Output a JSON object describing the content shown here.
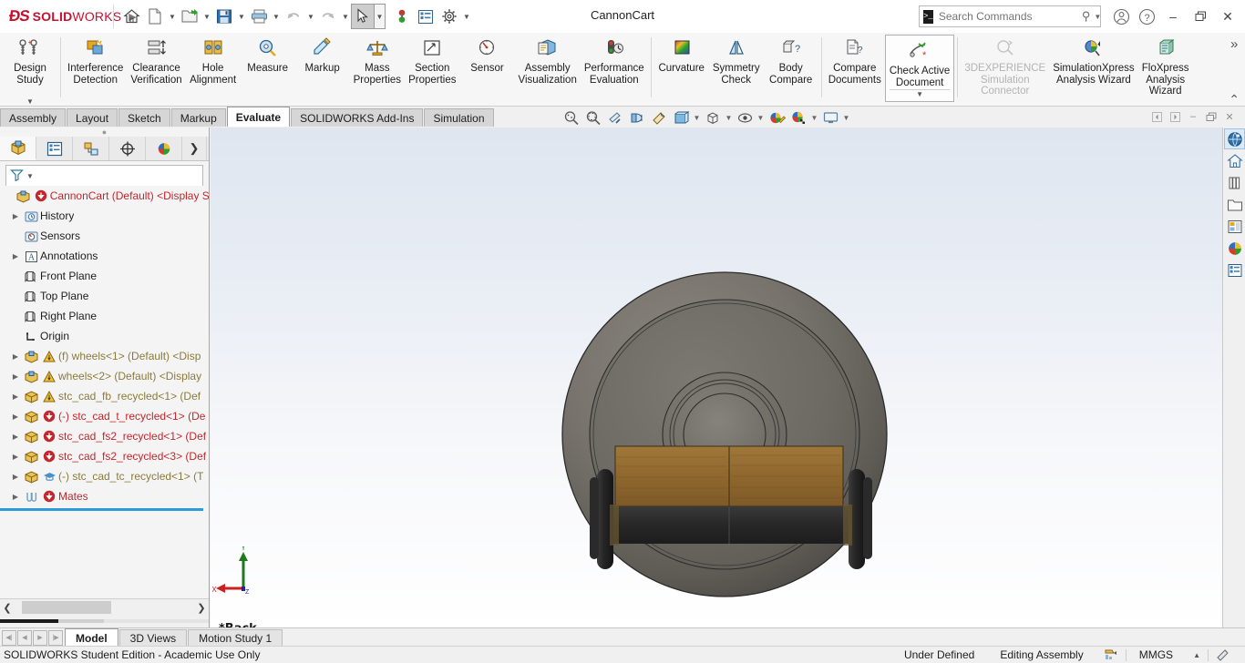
{
  "app": {
    "brand_ds": "2S",
    "brand_bold": "SOLID",
    "brand_light": "WORKS",
    "document_title": "CannonCart",
    "accent_red": "#c8102e",
    "accent_blue": "#2e9bd6"
  },
  "quick_access": [
    {
      "name": "home-icon",
      "label": "Home"
    },
    {
      "name": "new-document-icon",
      "label": "New",
      "caret": true
    },
    {
      "name": "open-folder-icon",
      "label": "Open",
      "caret": true
    },
    {
      "name": "save-icon",
      "label": "Save",
      "caret": true
    },
    {
      "name": "print-icon",
      "label": "Print",
      "caret": true
    },
    {
      "name": "undo-icon",
      "label": "Undo",
      "caret": true
    },
    {
      "name": "redo-icon",
      "label": "Redo",
      "caret": true
    },
    {
      "name": "select-cursor-icon",
      "label": "Select",
      "caret": true,
      "selected": true
    },
    {
      "name": "rebuild-icon",
      "label": "Rebuild"
    },
    {
      "name": "file-properties-icon",
      "label": "File Properties"
    },
    {
      "name": "options-gear-icon",
      "label": "Options",
      "caret": true
    }
  ],
  "titlebar_right": {
    "search_placeholder": "Search Commands",
    "search_value": "",
    "prompt_glyph": ">_",
    "search_icon": "search-icon",
    "search_caret": "chevron-down-icon",
    "account_icon": "user-account-icon",
    "help_icon": "help-question-icon",
    "minimize": "–",
    "restore": "❐",
    "close": "✕"
  },
  "ribbon": {
    "groups": [
      {
        "items": [
          {
            "name": "design-study-button",
            "label": "Design\nStudy",
            "icon": "design-study-icon",
            "dropdown": true,
            "disabled": false
          }
        ]
      },
      {
        "items": [
          {
            "name": "interference-detection-button",
            "label": "Interference\nDetection",
            "icon": "interference-detection-icon",
            "disabled": false
          },
          {
            "name": "clearance-verification-button",
            "label": "Clearance\nVerification",
            "icon": "clearance-verification-icon",
            "disabled": false
          },
          {
            "name": "hole-alignment-button",
            "label": "Hole\nAlignment",
            "icon": "hole-alignment-icon",
            "disabled": false
          },
          {
            "name": "measure-button",
            "label": "Measure",
            "icon": "measure-icon",
            "disabled": false
          },
          {
            "name": "markup-button",
            "label": "Markup",
            "icon": "markup-icon",
            "disabled": false
          },
          {
            "name": "mass-properties-button",
            "label": "Mass\nProperties",
            "icon": "mass-properties-icon",
            "disabled": false
          },
          {
            "name": "section-properties-button",
            "label": "Section\nProperties",
            "icon": "section-properties-icon",
            "disabled": false
          },
          {
            "name": "sensor-button",
            "label": "Sensor",
            "icon": "sensor-icon",
            "disabled": false
          },
          {
            "name": "assembly-visualization-button",
            "label": "Assembly\nVisualization",
            "icon": "assembly-visualization-icon",
            "disabled": false
          },
          {
            "name": "performance-evaluation-button",
            "label": "Performance\nEvaluation",
            "icon": "performance-evaluation-icon",
            "disabled": false
          }
        ]
      },
      {
        "items": [
          {
            "name": "curvature-button",
            "label": "Curvature",
            "icon": "curvature-icon",
            "disabled": false
          },
          {
            "name": "symmetry-check-button",
            "label": "Symmetry\nCheck",
            "icon": "symmetry-check-icon",
            "disabled": false
          },
          {
            "name": "body-compare-button",
            "label": "Body\nCompare",
            "icon": "body-compare-icon",
            "disabled": false
          }
        ]
      },
      {
        "items": [
          {
            "name": "compare-documents-button",
            "label": "Compare\nDocuments",
            "icon": "compare-documents-icon",
            "disabled": false
          },
          {
            "name": "check-active-document-button",
            "label": "Check Active\nDocument",
            "icon": "check-active-document-icon",
            "boxed": true,
            "dropdown": true,
            "disabled": false
          }
        ]
      },
      {
        "items": [
          {
            "name": "3dexperience-simulation-connector-button",
            "label": "3DEXPERIENCE\nSimulation\nConnector",
            "icon": "3dexperience-connector-icon",
            "disabled": true
          },
          {
            "name": "simulationxpress-analysis-wizard-button",
            "label": "SimulationXpress\nAnalysis Wizard",
            "icon": "simulationxpress-icon",
            "disabled": false
          },
          {
            "name": "floxpress-analysis-wizard-button",
            "label": "FloXpress\nAnalysis\nWizard",
            "icon": "floxpress-icon",
            "disabled": false
          }
        ]
      }
    ],
    "overflow_label": "»",
    "collapse_label": "⌃"
  },
  "command_tabs": [
    {
      "name": "tab-assembly",
      "label": "Assembly",
      "active": false
    },
    {
      "name": "tab-layout",
      "label": "Layout",
      "active": false
    },
    {
      "name": "tab-sketch",
      "label": "Sketch",
      "active": false
    },
    {
      "name": "tab-markup",
      "label": "Markup",
      "active": false
    },
    {
      "name": "tab-evaluate",
      "label": "Evaluate",
      "active": true
    },
    {
      "name": "tab-solidworks-add-ins",
      "label": "SOLIDWORKS Add-Ins",
      "active": false
    },
    {
      "name": "tab-simulation",
      "label": "Simulation",
      "active": false
    }
  ],
  "view_toolbar": [
    {
      "name": "zoom-to-fit-icon",
      "caret": false
    },
    {
      "name": "zoom-to-area-icon",
      "caret": false
    },
    {
      "name": "section-view-icon",
      "caret": false
    },
    {
      "name": "view-orientation-icon",
      "caret": false
    },
    {
      "name": "display-style-icon",
      "caret": false
    },
    {
      "name": "hide-show-items-icon",
      "caret": true
    },
    {
      "name": "view-setting-cube-icon",
      "caret": true
    },
    {
      "name": "apply-scene-eye-icon",
      "caret": true
    },
    {
      "name": "edit-appearance-icon",
      "caret": false
    },
    {
      "name": "apply-scene-icon",
      "caret": true
    },
    {
      "name": "view-settings-monitor-icon",
      "caret": true
    }
  ],
  "window_controls": {
    "prev": "◀",
    "next": "▶",
    "minimize": "–",
    "restore": "❐",
    "close": "✕"
  },
  "feature_manager": {
    "tabs": [
      {
        "name": "featuremanager-design-tree-tab",
        "icon": "feature-tree-icon",
        "active": true
      },
      {
        "name": "property-manager-tab",
        "icon": "property-manager-icon",
        "active": false
      },
      {
        "name": "configuration-manager-tab",
        "icon": "configuration-manager-icon",
        "active": false
      },
      {
        "name": "dimxpert-manager-tab",
        "icon": "dimxpert-icon",
        "active": false
      },
      {
        "name": "display-manager-tab",
        "icon": "display-manager-icon",
        "active": false
      },
      {
        "name": "expand-panel-tab",
        "icon": "chevron-right-icon",
        "active": false
      }
    ],
    "filter_icon": "filter-funnel-icon",
    "filter_placeholder": "",
    "tree": [
      {
        "name": "tree-item-root",
        "label": "CannonCart (Default) <Display St",
        "icon": "assembly-icon",
        "badge": "rebuild-error-icon",
        "arrow": false,
        "indent": 0,
        "color": "#c1272d"
      },
      {
        "name": "tree-item-history",
        "label": "History",
        "icon": "history-folder-icon",
        "arrow": true,
        "indent": 1,
        "color": "#1d1d1d"
      },
      {
        "name": "tree-item-sensors",
        "label": "Sensors",
        "icon": "sensors-folder-icon",
        "arrow": false,
        "indent": 1,
        "color": "#1d1d1d"
      },
      {
        "name": "tree-item-annotations",
        "label": "Annotations",
        "icon": "annotations-folder-icon",
        "arrow": true,
        "indent": 1,
        "color": "#1d1d1d"
      },
      {
        "name": "tree-item-front-plane",
        "label": "Front Plane",
        "icon": "plane-icon",
        "arrow": false,
        "indent": 1,
        "color": "#1d1d1d"
      },
      {
        "name": "tree-item-top-plane",
        "label": "Top Plane",
        "icon": "plane-icon",
        "arrow": false,
        "indent": 1,
        "color": "#1d1d1d"
      },
      {
        "name": "tree-item-right-plane",
        "label": "Right Plane",
        "icon": "plane-icon",
        "arrow": false,
        "indent": 1,
        "color": "#1d1d1d"
      },
      {
        "name": "tree-item-origin",
        "label": "Origin",
        "icon": "origin-icon",
        "arrow": false,
        "indent": 1,
        "color": "#1d1d1d"
      },
      {
        "name": "tree-item-wheels-1",
        "label": "(f) wheels<1>  (Default) <Disp",
        "icon": "part-blue-icon",
        "badge": "warning-icon",
        "arrow": true,
        "indent": 1,
        "color": "#8a7b3a"
      },
      {
        "name": "tree-item-wheels-2",
        "label": "wheels<2>  (Default) <Display",
        "icon": "part-blue-icon",
        "badge": "warning-icon",
        "arrow": true,
        "indent": 1,
        "color": "#8a7b3a"
      },
      {
        "name": "tree-item-stc-cad-fb-recycled-1",
        "label": "stc_cad_fb_recycled<1>  (Def",
        "icon": "part-yellow-icon",
        "badge": "warning-icon",
        "arrow": true,
        "indent": 1,
        "color": "#8a7b3a"
      },
      {
        "name": "tree-item-stc-cad-t-recycled-1",
        "label": "(-) stc_cad_t_recycled<1>  (De",
        "icon": "part-yellow-icon",
        "badge": "rebuild-error-icon",
        "arrow": true,
        "indent": 1,
        "color": "#c1272d"
      },
      {
        "name": "tree-item-stc-cad-fs2-recycled-1",
        "label": "stc_cad_fs2_recycled<1> (Def",
        "icon": "part-yellow-icon",
        "badge": "rebuild-error-icon",
        "arrow": true,
        "indent": 1,
        "color": "#c1272d"
      },
      {
        "name": "tree-item-stc-cad-fs2-recycled-3",
        "label": "stc_cad_fs2_recycled<3> (Def",
        "icon": "part-yellow-icon",
        "badge": "rebuild-error-icon",
        "arrow": true,
        "indent": 1,
        "color": "#c1272d"
      },
      {
        "name": "tree-item-stc-cad-tc-recycled-1",
        "label": "(-) stc_cad_tc_recycled<1>  (T",
        "icon": "part-yellow-icon",
        "badge": "student-cap-icon",
        "arrow": true,
        "indent": 1,
        "color": "#8a7b3a"
      },
      {
        "name": "tree-item-mates",
        "label": "Mates",
        "icon": "mates-paperclip-icon",
        "badge": "rebuild-error-icon",
        "arrow": true,
        "indent": 1,
        "color": "#c1272d"
      }
    ],
    "scroll_left_icon": "chevron-left-icon",
    "scroll_right_icon": "chevron-right-icon"
  },
  "graphics": {
    "view_label": "*Back",
    "triad": {
      "x_label": "X",
      "y_label": "Y",
      "z_label": "Z",
      "x_color": "#cc2020",
      "y_color": "#1d7a1d",
      "z_color": "#2222aa"
    },
    "model_colors": {
      "barrel_metal": "#6e6b65",
      "barrel_metal_dark": "#56534e",
      "wood": "#9a6f33",
      "wood_dark": "#7d5a27",
      "iron": "#2b2b2b"
    },
    "background_top": "#dfe6f0",
    "background_bottom": "#ffffff"
  },
  "task_pane": [
    {
      "name": "3dexperience-marketplace-icon",
      "active": true
    },
    {
      "name": "solidworks-resources-home-icon",
      "active": false
    },
    {
      "name": "design-library-icon",
      "active": false
    },
    {
      "name": "file-explorer-icon",
      "active": false
    },
    {
      "name": "view-palette-icon",
      "active": false
    },
    {
      "name": "appearances-scenes-decals-icon",
      "active": false
    },
    {
      "name": "custom-properties-icon",
      "active": false
    }
  ],
  "bottom_tabs": {
    "nav_buttons": [
      "first-tab-icon",
      "prev-tab-icon",
      "next-tab-icon",
      "last-tab-icon"
    ],
    "tabs": [
      {
        "name": "bottom-tab-model",
        "label": "Model",
        "active": true
      },
      {
        "name": "bottom-tab-3d-views",
        "label": "3D Views",
        "active": false
      },
      {
        "name": "bottom-tab-motion-study-1",
        "label": "Motion Study 1",
        "active": false
      }
    ]
  },
  "status_bar": {
    "license_text": "SOLIDWORKS Student Edition - Academic Use Only",
    "sketch_state": "Under Defined",
    "edit_mode": "Editing Assembly",
    "overdefined_icon": "assembly-editing-icon",
    "units": "MMGS",
    "units_caret": "▲",
    "tools_icon": "options-tools-icon"
  }
}
